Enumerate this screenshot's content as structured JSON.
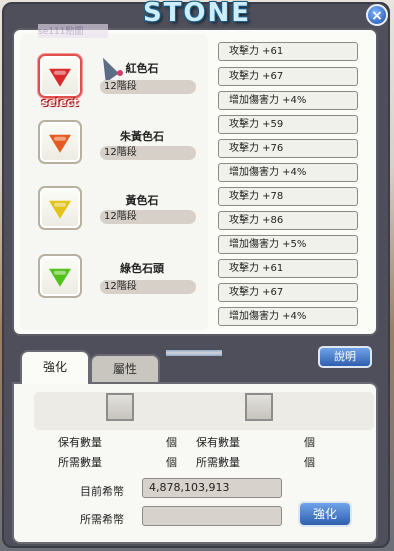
{
  "window": {
    "title": "STONE",
    "close_label": "×"
  },
  "overlay_text": "se111點圖",
  "select_label": "select",
  "gems": [
    {
      "name": "紅色石",
      "tier": "12階段",
      "color": "#d92a2a",
      "selected": true,
      "stats": [
        "攻擊力 +61",
        "攻擊力 +67",
        "增加傷害力 +4%"
      ]
    },
    {
      "name": "朱黃色石",
      "tier": "12階段",
      "color": "#e55a1e",
      "selected": false,
      "stats": [
        "攻擊力 +59",
        "攻擊力 +76",
        "增加傷害力 +4%"
      ]
    },
    {
      "name": "黃色石",
      "tier": "12階段",
      "color": "#e3c21a",
      "selected": false,
      "stats": [
        "攻擊力 +78",
        "攻擊力 +86",
        "增加傷害力 +5%"
      ]
    },
    {
      "name": "綠色石頭",
      "tier": "12階段",
      "color": "#52c21a",
      "selected": false,
      "stats": [
        "攻擊力 +61",
        "攻擊力 +67",
        "增加傷害力 +4%"
      ]
    }
  ],
  "tabs": [
    {
      "label": "強化",
      "active": true
    },
    {
      "label": "屬性",
      "active": false
    }
  ],
  "description_button": "說明",
  "materials": {
    "held_label": "保有數量",
    "required_label": "所需數量",
    "unit": "個"
  },
  "currency": {
    "current_label": "目前希幣",
    "current_value": "4,878,103,913",
    "required_label": "所需希幣",
    "required_value": ""
  },
  "upgrade_button": "強化"
}
